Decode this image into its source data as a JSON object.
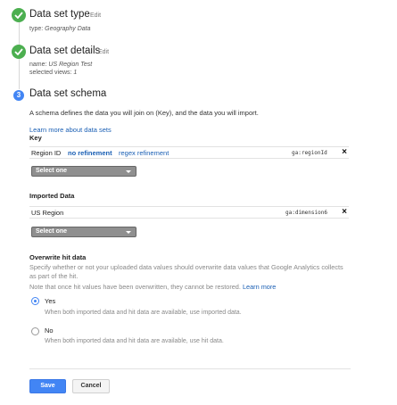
{
  "steps": [
    {
      "title": "Data set type",
      "edit_label": "Edit",
      "detail_lines": [
        {
          "prefix": "type: ",
          "value": "Geography Data"
        }
      ]
    },
    {
      "title": "Data set details",
      "edit_label": "Edit",
      "detail_lines": [
        {
          "prefix": "name: ",
          "value": "US Region Test"
        },
        {
          "prefix": "selected views: ",
          "value": "1"
        }
      ]
    },
    {
      "number": "3",
      "title": "Data set schema",
      "description": "A schema defines the data you will join on (Key), and the data you will import.",
      "learn_more": "Learn more about data sets"
    }
  ],
  "key_section": {
    "label": "Key",
    "row": {
      "name": "Region ID",
      "option_active": "no refinement",
      "option_other": "regex refinement",
      "code": "ga:regionId",
      "remove": "×"
    },
    "select_placeholder": "Select one"
  },
  "imported_section": {
    "label": "Imported Data",
    "row": {
      "name": "US Region",
      "code": "ga:dimension6",
      "remove": "×"
    },
    "select_placeholder": "Select one"
  },
  "overwrite": {
    "label": "Overwrite hit data",
    "desc1": "Specify whether or not your uploaded data values should overwrite data values that Google Analytics collects",
    "desc2": "as part of the hit.",
    "desc3": "Note that once hit values have been overwritten, they cannot be restored.",
    "learn_more": "Learn more",
    "options": [
      {
        "label": "Yes",
        "desc": "When both imported data and hit data are available, use imported data.",
        "checked": true
      },
      {
        "label": "No",
        "desc": "When both imported data and hit data are available, use hit data.",
        "checked": false
      }
    ]
  },
  "actions": {
    "save_label": "Save",
    "cancel_label": "Cancel"
  },
  "colors": {
    "accent": "#4285f4",
    "done": "#4caf50",
    "link": "#1a5fb4"
  }
}
